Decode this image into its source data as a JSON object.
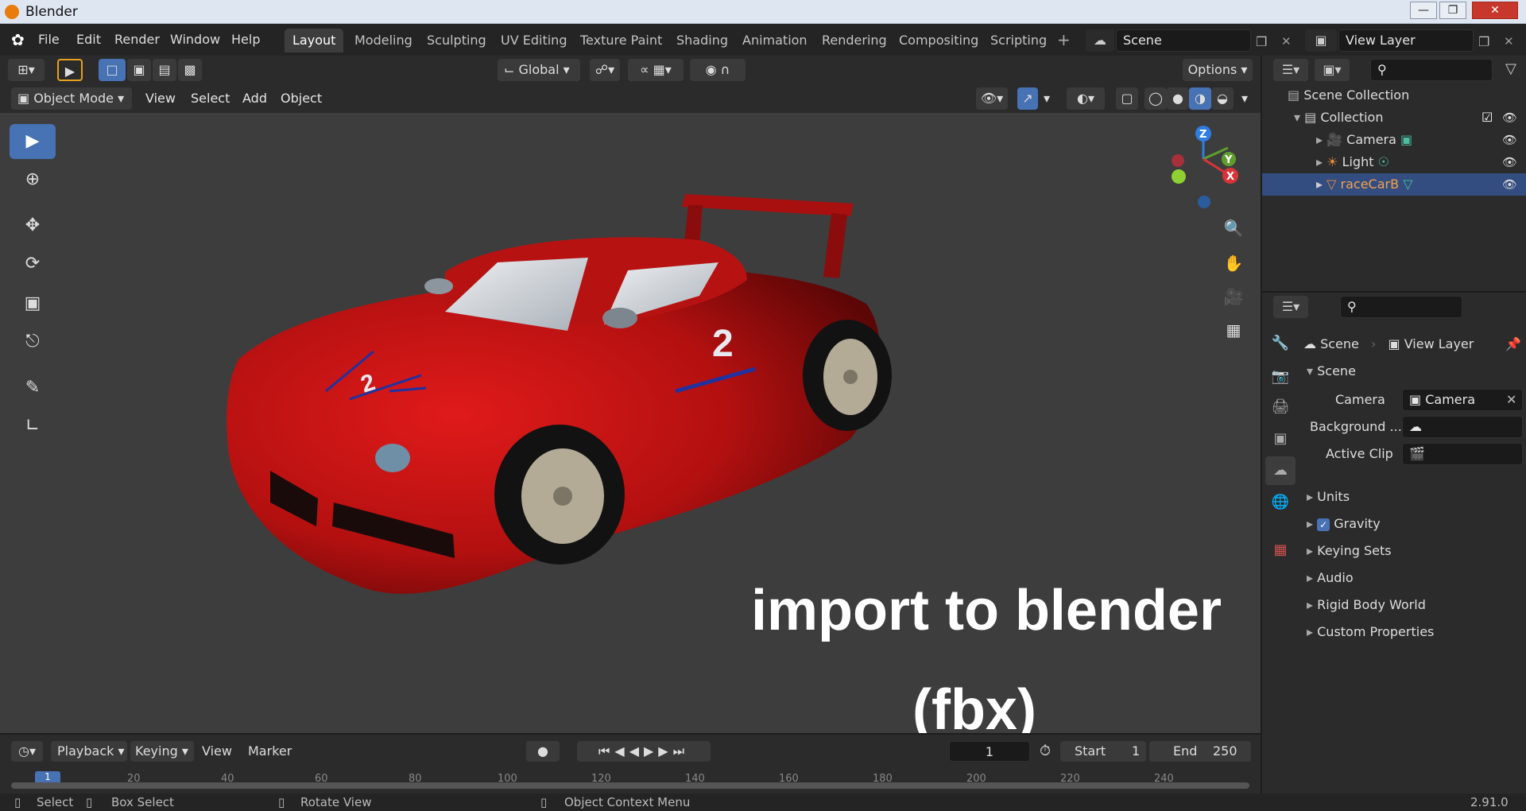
{
  "window": {
    "title": "Blender"
  },
  "menus": [
    "File",
    "Edit",
    "Render",
    "Window",
    "Help"
  ],
  "workspace_tabs": [
    "Layout",
    "Modeling",
    "Sculpting",
    "UV Editing",
    "Texture Paint",
    "Shading",
    "Animation",
    "Rendering",
    "Compositing",
    "Scripting"
  ],
  "active_tab": "Layout",
  "scene_field": "Scene",
  "view_layer_field": "View Layer",
  "header": {
    "transform_orientation": "Global",
    "options": "Options",
    "mode": "Object Mode",
    "view": "View",
    "select": "Select",
    "add": "Add",
    "object": "Object"
  },
  "gizmo": {
    "z": "Z",
    "y": "Y",
    "x": "X"
  },
  "overlay": {
    "line1": "import to blender",
    "line2": "(fbx)"
  },
  "viewport_object": {
    "number": "2"
  },
  "timeline": {
    "playback": "Playback",
    "keying": "Keying",
    "view": "View",
    "marker": "Marker",
    "current_frame": "1",
    "start_label": "Start",
    "start_value": "1",
    "end_label": "End",
    "end_value": "250",
    "ticks": [
      "1",
      "20",
      "40",
      "60",
      "80",
      "100",
      "120",
      "140",
      "160",
      "180",
      "200",
      "220",
      "240"
    ]
  },
  "outliner": {
    "root": "Scene Collection",
    "collection": "Collection",
    "items": [
      {
        "label": "Camera",
        "icon": "camera-icon"
      },
      {
        "label": "Light",
        "icon": "light-icon"
      },
      {
        "label": "raceCarB",
        "icon": "mesh-icon",
        "selected": true
      }
    ]
  },
  "properties": {
    "breadcrumb_scene": "Scene",
    "breadcrumb_view_layer": "View Layer",
    "panel_title": "Scene",
    "camera_label": "Camera",
    "camera_value": "Camera",
    "background_label": "Background ...",
    "active_clip_label": "Active Clip",
    "sections": [
      "Units",
      "Gravity",
      "Keying Sets",
      "Audio",
      "Rigid Body World",
      "Custom Properties"
    ],
    "gravity_checked": true
  },
  "statusbar": {
    "select": "Select",
    "box_select": "Box Select",
    "rotate_view": "Rotate View",
    "context_menu": "Object Context Menu",
    "version": "2.91.0"
  },
  "colors": {
    "accent": "#4772b3",
    "selected_row": "#334d80",
    "car_red": "#c81414",
    "bg_viewport": "#3d3d3d"
  }
}
